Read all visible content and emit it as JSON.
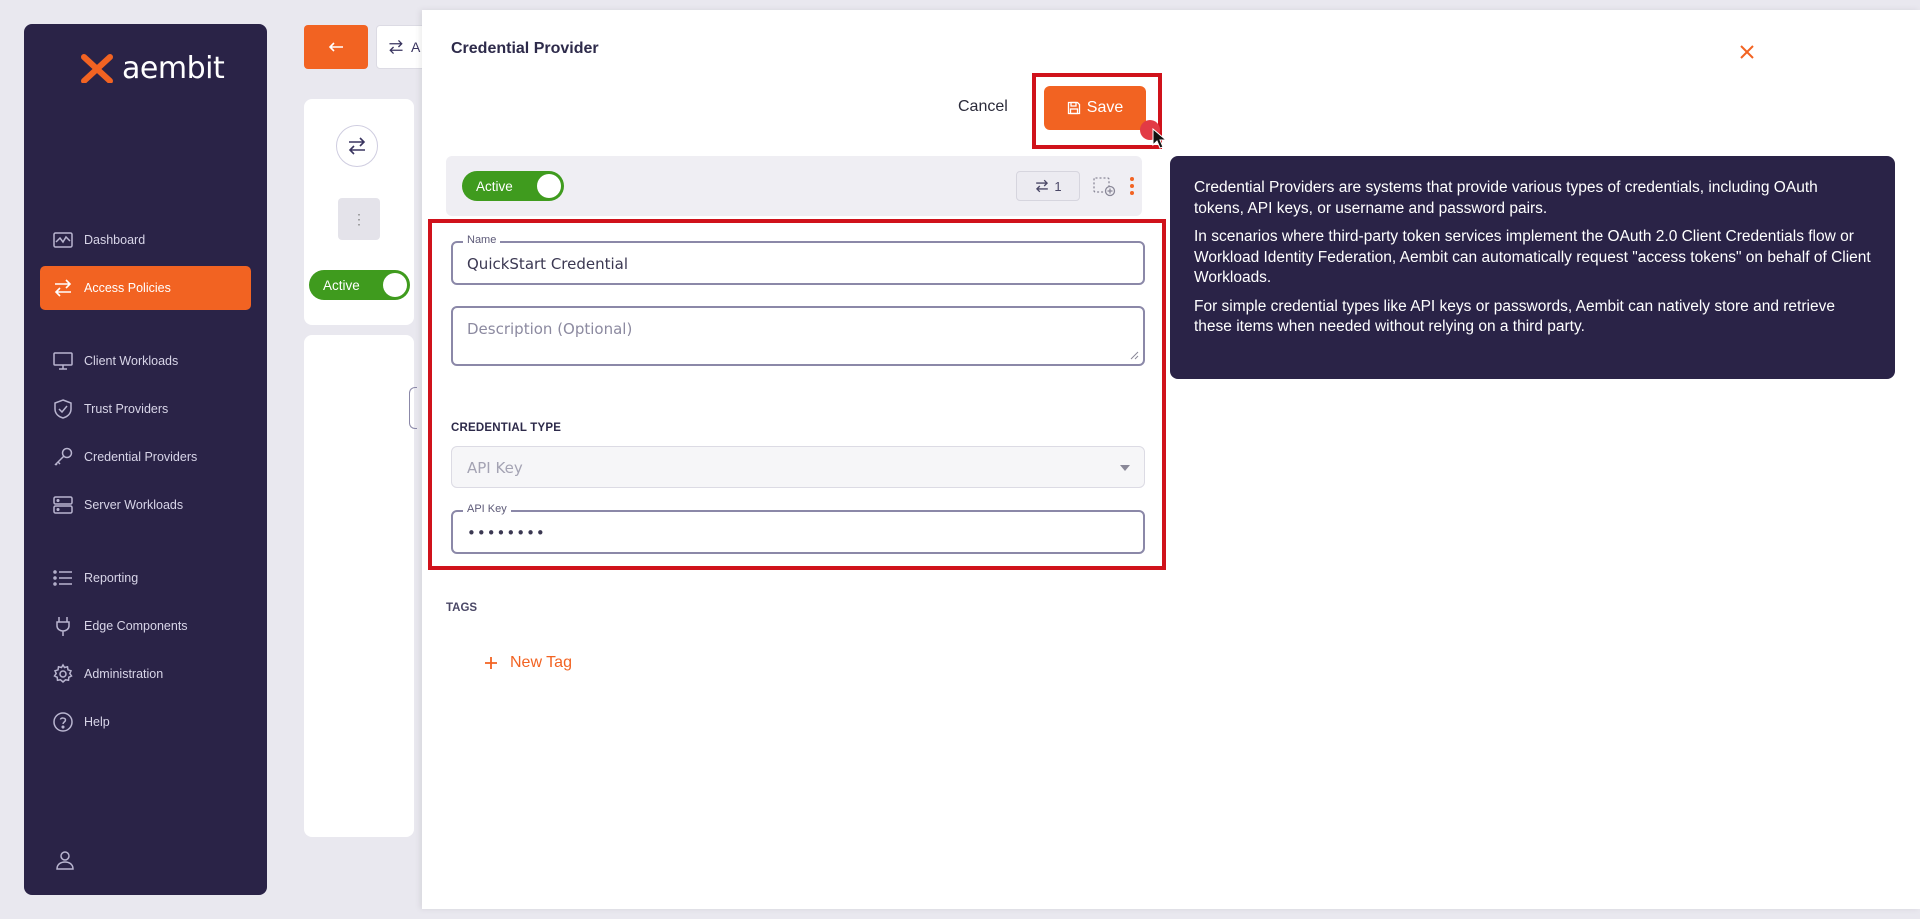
{
  "sidebar": {
    "logo_text": "aembit",
    "items": [
      {
        "label": "Dashboard",
        "icon": "dashboard-icon"
      },
      {
        "label": "Access Policies",
        "icon": "arrows-icon",
        "active": true
      },
      {
        "label": "Client Workloads",
        "icon": "monitor-icon"
      },
      {
        "label": "Trust Providers",
        "icon": "shield-icon"
      },
      {
        "label": "Credential Providers",
        "icon": "key-icon"
      },
      {
        "label": "Server Workloads",
        "icon": "server-icon"
      },
      {
        "label": "Reporting",
        "icon": "list-icon"
      },
      {
        "label": "Edge Components",
        "icon": "plug-icon"
      },
      {
        "label": "Administration",
        "icon": "gear-icon"
      },
      {
        "label": "Help",
        "icon": "help-icon"
      }
    ]
  },
  "background": {
    "tab_label": "A",
    "toggle_label": "Active"
  },
  "panel": {
    "title": "Credential Provider",
    "cancel_label": "Cancel",
    "save_label": "Save",
    "status": {
      "toggle_label": "Active",
      "link_count": "1"
    },
    "form": {
      "name_label": "Name",
      "name_value": "QuickStart Credential",
      "description_placeholder": "Description (Optional)",
      "credential_type_heading": "CREDENTIAL TYPE",
      "credential_type_value": "API Key",
      "api_key_label": "API Key",
      "api_key_value": "••••••••"
    },
    "tags": {
      "heading": "TAGS",
      "new_tag_label": "New Tag"
    }
  },
  "info": {
    "paragraphs": [
      "Credential Providers are systems that provide various types of credentials, including OAuth tokens, API keys, or username and password pairs.",
      "In scenarios where third-party token services implement the OAuth 2.0 Client Credentials flow or Workload Identity Federation, Aembit can automatically request \"access tokens\" on behalf of Client Workloads.",
      "For simple credential types like API keys or passwords, Aembit can natively store and retrieve these items when needed without relying on a third party."
    ]
  },
  "colors": {
    "accent": "#f26322",
    "sidebar_bg": "#2a2347",
    "active_green": "#3f9b1e",
    "highlight_red": "#d0121b"
  }
}
